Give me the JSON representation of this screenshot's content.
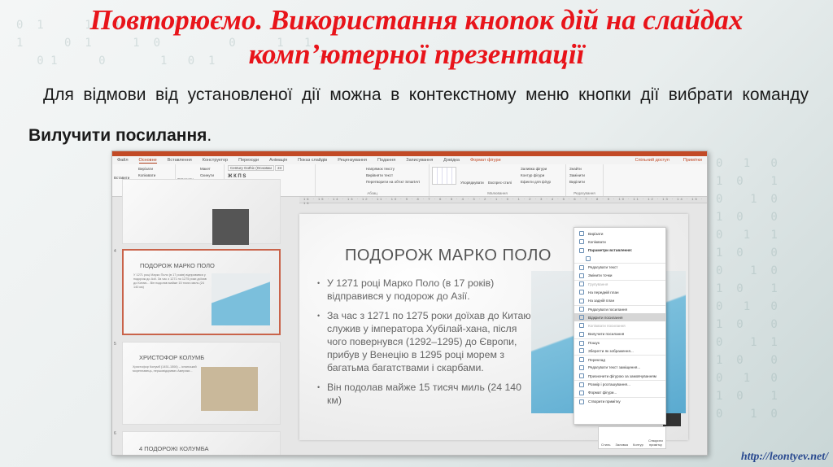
{
  "title": {
    "line1": "Повторюємо. Використання кнопок дій на слайдах",
    "line2": "комп’ютерної презентації"
  },
  "body": {
    "text_before": "Для відмови від установленої дії можна в контекстному меню кнопки дії вибрати команду ",
    "bold": "Вилучити посилання",
    "text_after": "."
  },
  "ppt": {
    "tabs": [
      "Файл",
      "Основне",
      "Вставлення",
      "Конструктор",
      "Переходи",
      "Анімація",
      "Показ слайдів",
      "Рецензування",
      "Подання",
      "Записування",
      "Довідка",
      "Формат фігури"
    ],
    "share": "Спільний доступ",
    "comments": "Примітки",
    "groups": [
      {
        "label": "Буфер обміну",
        "items": [
          "Вставити",
          "Вирізати",
          "Копіювати",
          "Формат за зразком"
        ]
      },
      {
        "label": "Слайди",
        "items": [
          "Створити слайд",
          "Макет",
          "Скинути",
          "Розділ"
        ]
      },
      {
        "label": "Шрифт",
        "items": [
          "Century Gothic (Основни",
          "24"
        ]
      },
      {
        "label": "Абзац",
        "items": [
          "Напрямок тексту",
          "Вирівняти текст",
          "Перетворити на об'єкт SmartArt"
        ]
      },
      {
        "label": "Малювання",
        "items": [
          "Упорядкувати",
          "Експрес-стилі",
          "Заливка фігури",
          "Контур фігури",
          "Ефекти для фігур"
        ]
      },
      {
        "label": "Редагування",
        "items": [
          "Знайти",
          "Замінити",
          "Виділити"
        ]
      }
    ],
    "ruler": "16 · 15 · 14 · 13 · 12 · 11 · 10 · 9 · 8 · 7 · 6 · 5 · 4 · 3 · 2 · 1 · 0 · 1 · 2 · 3 · 4 · 5 · 6 · 7 · 8 · 9 · 10 · 11 · 12 · 13 · 14 · 15 · 16",
    "thumbnails": [
      {
        "num": "4",
        "title": "ПОДОРОЖ МАРКО ПОЛО",
        "text": "У 1271 році Марко Поло (в 17 років) відправився у подорож до Азії. За час з 1271 по 1275 роки доїхав до Китаю... Він подолав майже 15 тисяч миль (24 140 км)"
      },
      {
        "num": "5",
        "title": "ХРИСТОФОР КОЛУМБ",
        "text": "Христофор Колумб (1451-1506) – іспанський мореплавець, першовідкривач Америки..."
      },
      {
        "num": "6",
        "title": "4 ПОДОРОЖІ КОЛУМБА",
        "text": ""
      }
    ],
    "slide": {
      "title": "ПОДОРОЖ МАРКО ПОЛО",
      "bullets": [
        "У 1271 році Марко Поло (в 17 років) відправився у подорож до Азії.",
        "За час з 1271 по 1275 роки доїхав до Китаю, служив у імператора Хубілай-хана, після чого повернувся (1292–1295) до Європи, прибув у Венецію в 1295 році морем з багатьма багатствами і скарбами.",
        "Він подолав майже 15 тисяч миль (24 140 км)"
      ]
    },
    "context_menu": [
      "Вирізати",
      "Копіювати",
      "Параметри вставлення:",
      "",
      "Редагувати текст",
      "Змінити точки",
      "Групування",
      "На передній план",
      "На задній план",
      "Редагувати посилання",
      "Відкрити посилання",
      "Копіювати посилання",
      "Вилучити посилання",
      "Пошук",
      "Зберегти як зображення...",
      "Переклад",
      "Редагувати текст заміщення...",
      "Призначити фігурою за замовчуванням",
      "Розмір і розташування...",
      "Формат фігури...",
      "Створити примітку"
    ],
    "mini_toolbar": [
      "Стиль",
      "Заливка",
      "Контур",
      "Створити примітку"
    ]
  },
  "footer": "http://leontyev.net/"
}
